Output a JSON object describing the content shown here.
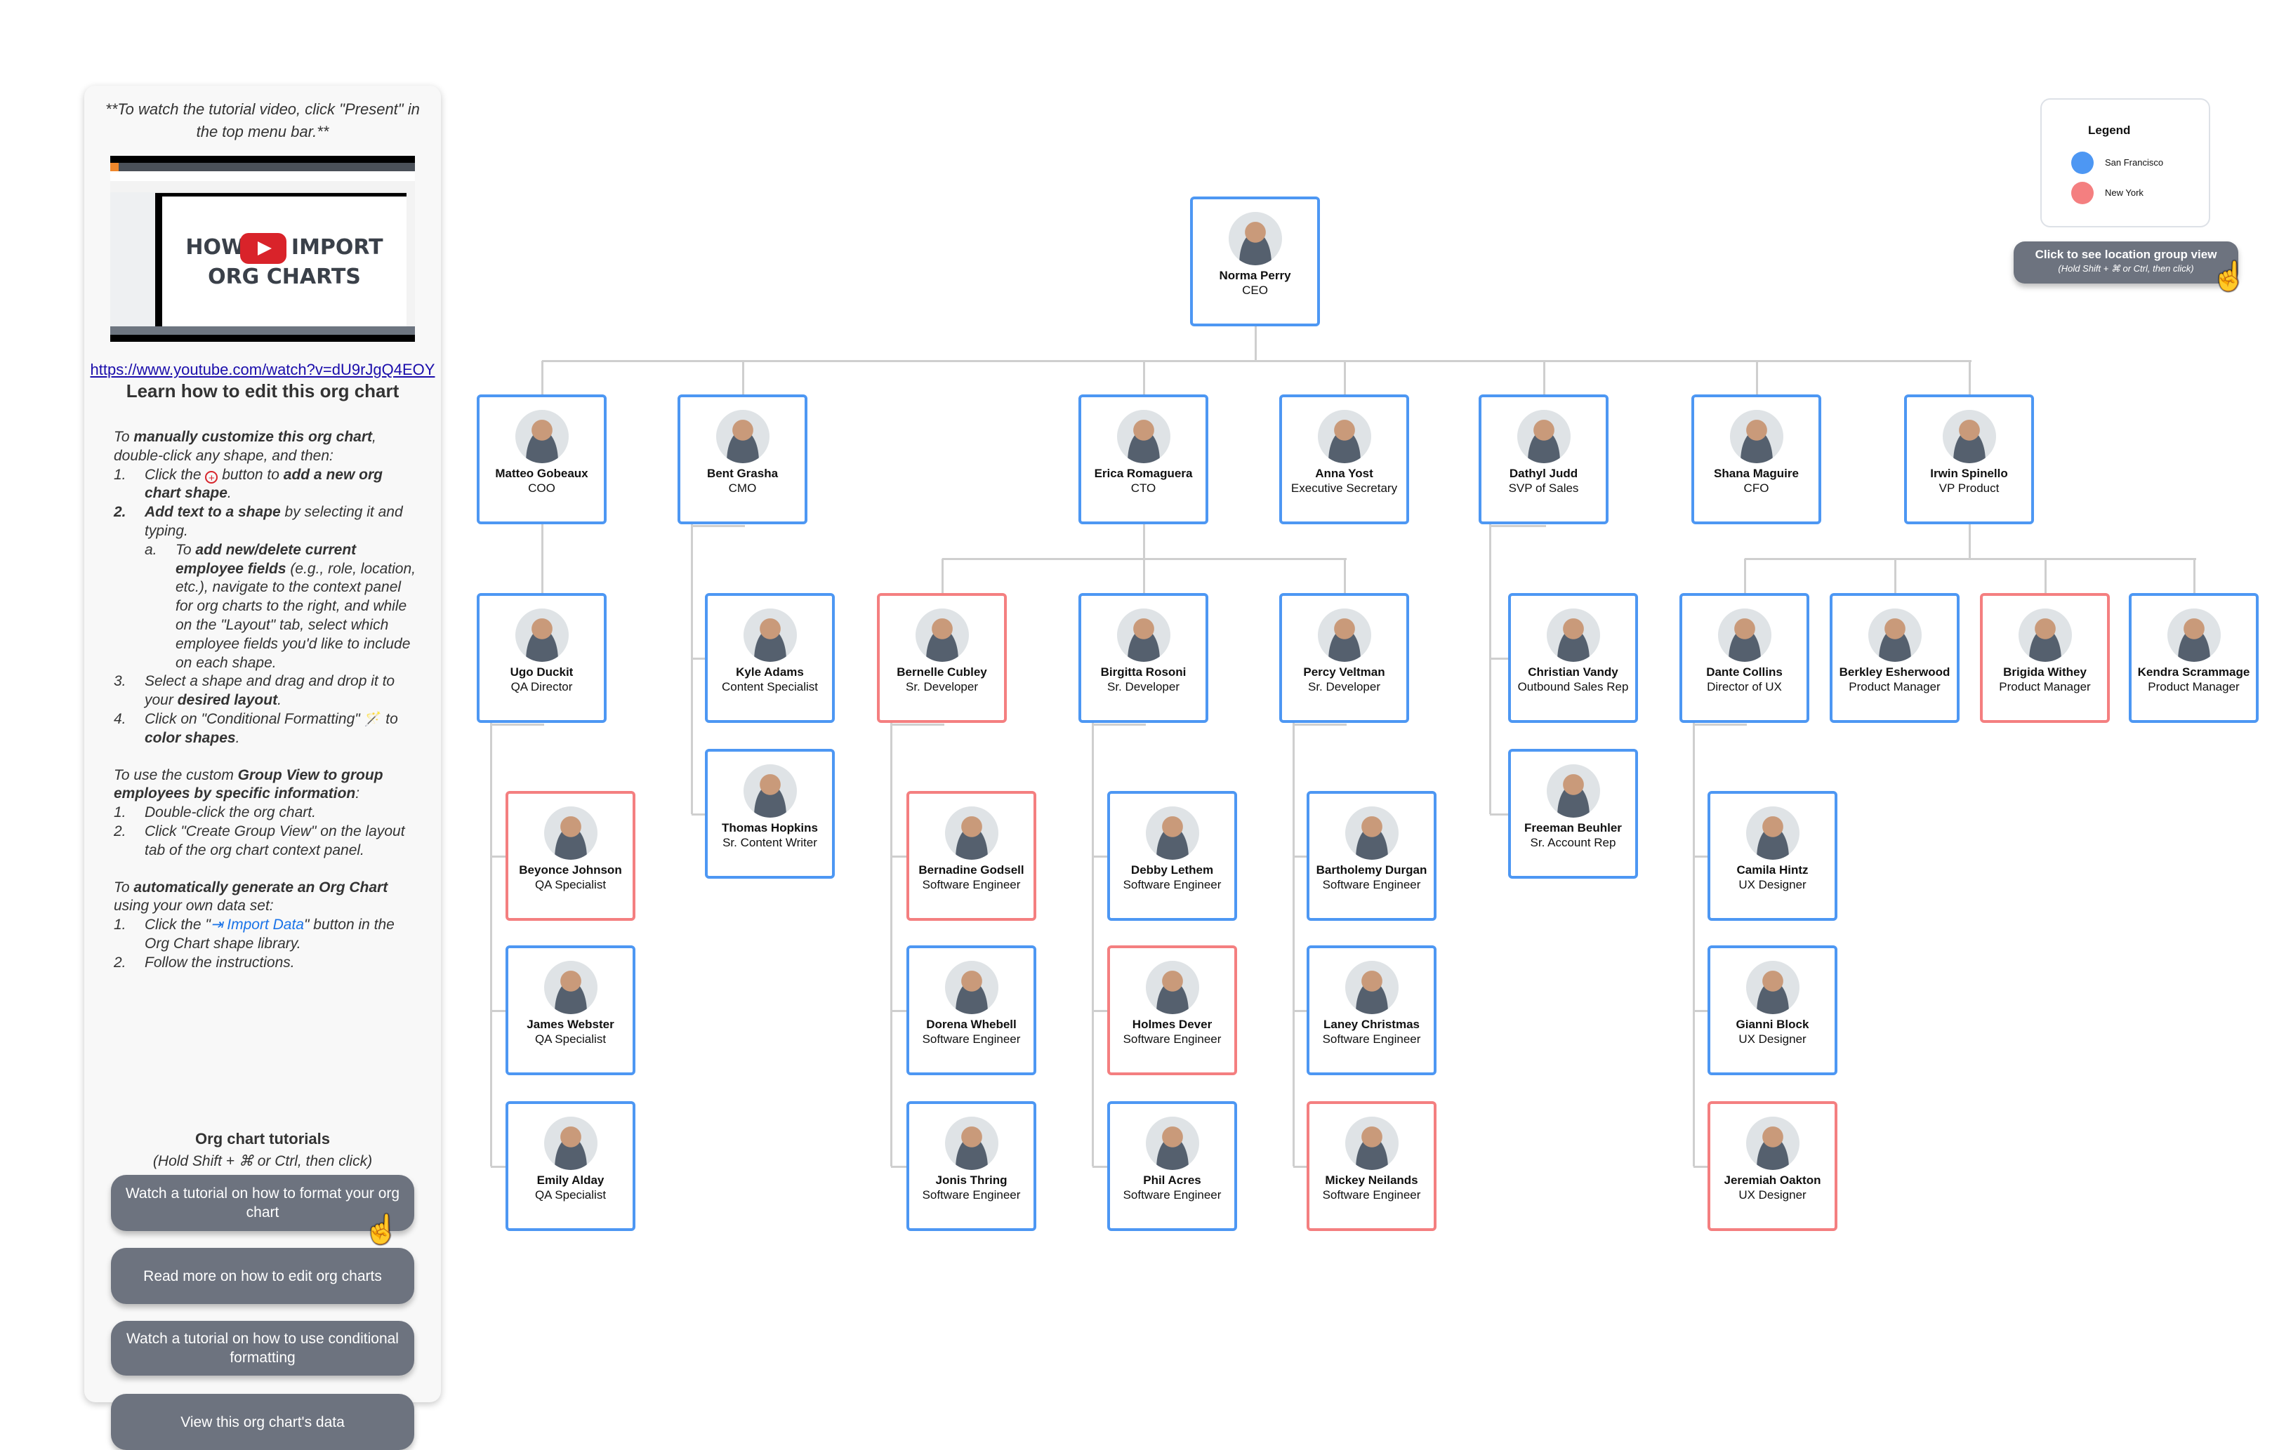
{
  "sidebar": {
    "note": "**To watch the tutorial video, click \"Present\" in the top menu bar.**",
    "video": {
      "title_line1": "HOW TO IMPORT",
      "title_line2": "ORG CHARTS",
      "icon": "youtube-play-icon"
    },
    "video_link": "https://www.youtube.com/watch?v=dU9rJgQ4EOY",
    "heading": "Learn how to edit this org chart",
    "manual": {
      "intro_pre": "To ",
      "intro_bold": "manually customize this org chart",
      "intro_post": ", double-click any shape, and then:",
      "steps": [
        {
          "n": "1.",
          "pre": "Click the ",
          "icon": "add-circle-icon",
          "mid": " button to ",
          "bold": "add a new org chart shape",
          "post": "."
        },
        {
          "n": "2.",
          "bold": "Add text to a shape",
          "post": " by selecting it and typing."
        },
        {
          "n": "a.",
          "pre": "To ",
          "bold": "add new/delete current employee fields",
          "post": " (e.g., role, location, etc.), navigate to the context panel for org charts to the right, and while on the \"Layout\" tab, select which employee fields you'd like to include on each shape."
        },
        {
          "n": "3.",
          "pre": "Select a shape and drag and drop it to your ",
          "bold": "desired layout",
          "post": "."
        },
        {
          "n": "4.",
          "pre": "Click on \"Conditional Formatting\" ",
          "icon": "magic-wand-icon",
          "mid": " to ",
          "bold": "color shapes",
          "post": "."
        }
      ]
    },
    "group": {
      "intro_pre": "To use the custom ",
      "intro_bold": "Group View to group employees by specific information",
      "intro_post": ":",
      "steps": [
        {
          "n": "1.",
          "text": "Double-click the org chart."
        },
        {
          "n": "2.",
          "text": "Click \"Create Group View\" on the layout tab of the org chart context panel."
        }
      ]
    },
    "auto": {
      "intro_pre": "To ",
      "intro_bold": "automatically generate an Org Chart",
      "intro_post": " using your own data set:",
      "steps": [
        {
          "n": "1.",
          "pre": "Click the \"",
          "link": "Import Data",
          "post": "\" button in the Org Chart shape library."
        },
        {
          "n": "2.",
          "text": "Follow the instructions."
        }
      ]
    },
    "tutorials_title": "Org chart tutorials",
    "tutorials_hint": "(Hold Shift + ⌘ or Ctrl, then click)",
    "buttons": [
      "Watch a tutorial on how to format your org chart",
      "Read more on how to edit org charts",
      "Watch a tutorial on how to use conditional formatting",
      "View this org chart's data"
    ]
  },
  "legend": {
    "title": "Legend",
    "items": [
      {
        "label": "San Francisco",
        "color": "#4d97f3"
      },
      {
        "label": "New York",
        "color": "#f47f80"
      }
    ]
  },
  "group_view_button": {
    "label": "Click to see location group view",
    "hint": "(Hold Shift + ⌘ or Ctrl, then click)"
  },
  "org": [
    {
      "name": "Norma Perry",
      "role": "CEO",
      "loc": "sf"
    },
    {
      "name": "Matteo Gobeaux",
      "role": "COO",
      "loc": "sf"
    },
    {
      "name": "Bent Grasha",
      "role": "CMO",
      "loc": "sf"
    },
    {
      "name": "Erica Romaguera",
      "role": "CTO",
      "loc": "sf"
    },
    {
      "name": "Anna Yost",
      "role": "Executive Secretary",
      "loc": "sf"
    },
    {
      "name": "Dathyl Judd",
      "role": "SVP of Sales",
      "loc": "sf"
    },
    {
      "name": "Shana Maguire",
      "role": "CFO",
      "loc": "sf"
    },
    {
      "name": "Irwin Spinello",
      "role": "VP Product",
      "loc": "sf"
    },
    {
      "name": "Ugo Duckit",
      "role": "QA Director",
      "loc": "sf"
    },
    {
      "name": "Kyle Adams",
      "role": "Content Specialist",
      "loc": "sf"
    },
    {
      "name": "Bernelle Cubley",
      "role": "Sr. Developer",
      "loc": "ny"
    },
    {
      "name": "Birgitta Rosoni",
      "role": "Sr. Developer",
      "loc": "sf"
    },
    {
      "name": "Percy Veltman",
      "role": "Sr. Developer",
      "loc": "sf"
    },
    {
      "name": "Christian Vandy",
      "role": "Outbound Sales Rep",
      "loc": "sf"
    },
    {
      "name": "Dante Collins",
      "role": "Director of UX",
      "loc": "sf"
    },
    {
      "name": "Berkley Esherwood",
      "role": "Product Manager",
      "loc": "sf"
    },
    {
      "name": "Brigida Withey",
      "role": "Product Manager",
      "loc": "ny"
    },
    {
      "name": "Kendra Scrammage",
      "role": "Product Manager",
      "loc": "sf"
    },
    {
      "name": "Thomas Hopkins",
      "role": "Sr. Content Writer",
      "loc": "sf"
    },
    {
      "name": "Freeman Beuhler",
      "role": "Sr. Account Rep",
      "loc": "sf"
    },
    {
      "name": "Beyonce Johnson",
      "role": "QA Specialist",
      "loc": "ny"
    },
    {
      "name": "James Webster",
      "role": "QA Specialist",
      "loc": "sf"
    },
    {
      "name": "Emily Alday",
      "role": "QA Specialist",
      "loc": "sf"
    },
    {
      "name": "Bernadine Godsell",
      "role": "Software Engineer",
      "loc": "ny"
    },
    {
      "name": "Dorena Whebell",
      "role": "Software Engineer",
      "loc": "sf"
    },
    {
      "name": "Jonis Thring",
      "role": "Software Engineer",
      "loc": "sf"
    },
    {
      "name": "Debby Lethem",
      "role": "Software Engineer",
      "loc": "sf"
    },
    {
      "name": "Holmes Dever",
      "role": "Software Engineer",
      "loc": "ny"
    },
    {
      "name": "Phil Acres",
      "role": "Software Engineer",
      "loc": "sf"
    },
    {
      "name": "Bartholemy Durgan",
      "role": "Software Engineer",
      "loc": "sf"
    },
    {
      "name": "Laney Christmas",
      "role": "Software Engineer",
      "loc": "sf"
    },
    {
      "name": "Mickey Neilands",
      "role": "Software Engineer",
      "loc": "ny"
    },
    {
      "name": "Camila Hintz",
      "role": "UX Designer",
      "loc": "sf"
    },
    {
      "name": "Gianni Block",
      "role": "UX Designer",
      "loc": "sf"
    },
    {
      "name": "Jeremiah Oakton",
      "role": "UX Designer",
      "loc": "ny"
    }
  ]
}
